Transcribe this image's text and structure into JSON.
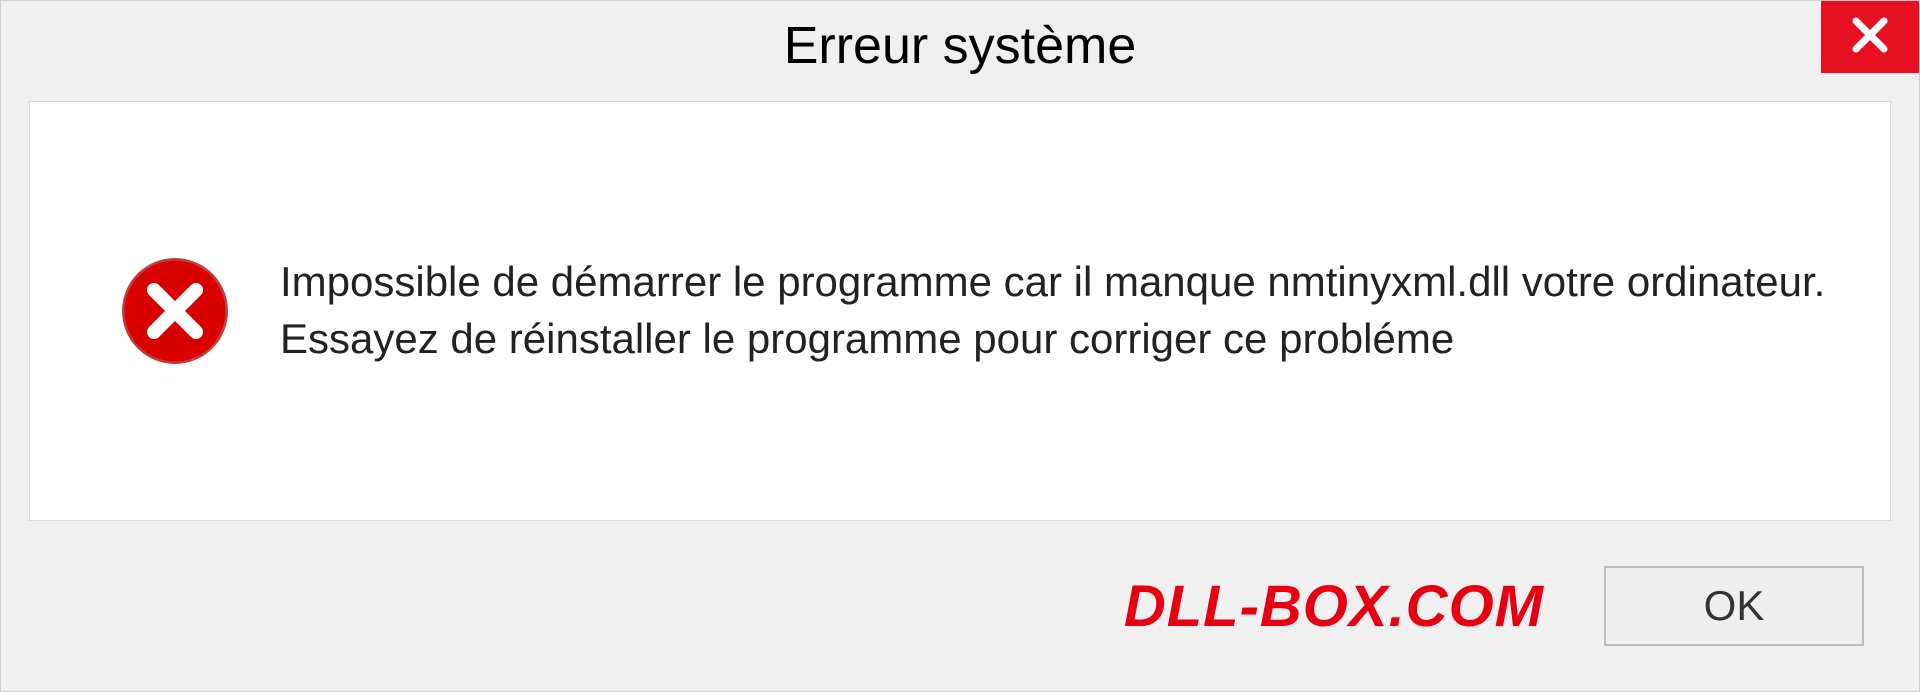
{
  "dialog": {
    "title": "Erreur système",
    "message": "Impossible de démarrer le programme car il manque nmtinyxml.dll votre ordinateur. Essayez de réinstaller le programme pour corriger ce probléme",
    "ok_label": "OK"
  },
  "brand": {
    "text": "DLL-BOX.COM"
  },
  "colors": {
    "close_bg": "#e81123",
    "brand_color": "#e60012"
  }
}
